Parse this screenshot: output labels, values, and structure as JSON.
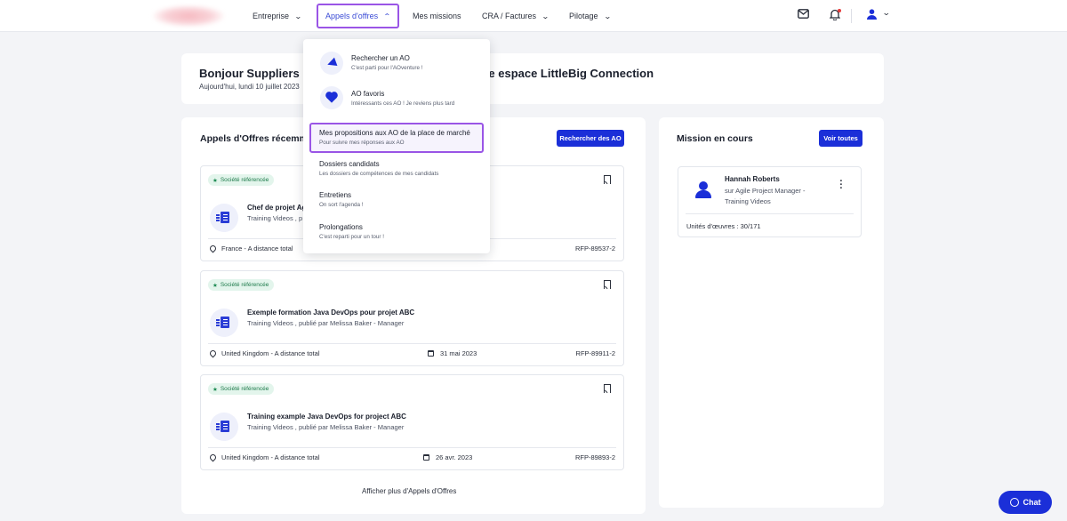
{
  "nav": {
    "items": [
      {
        "label": "Entreprise"
      },
      {
        "label": "Appels d'offres"
      },
      {
        "label": "Mes missions"
      },
      {
        "label": "CRA / Factures"
      },
      {
        "label": "Pilotage"
      }
    ],
    "icons": [
      "mail-icon",
      "bell-icon",
      "user-icon",
      "chevron-down-icon"
    ]
  },
  "dropdown": {
    "items": [
      {
        "label": "Rechercher un AO",
        "sub": "C'est parti pour l'AOventure !",
        "icon": "paper-plane-icon"
      },
      {
        "label": "AO favoris",
        "sub": "Intéressants ces AO ! Je reviens plus tard",
        "icon": "heart-icon"
      },
      {
        "label": "Mes propositions aux AO de la place de marché",
        "sub": "Pour suivre mes réponses aux AO"
      },
      {
        "label": "Dossiers candidats",
        "sub": "Les dossiers de compétences de mes candidats"
      },
      {
        "label": "Entretiens",
        "sub": "On sort l'agenda !"
      },
      {
        "label": "Prolongations",
        "sub": "C'est reparti pour un tour !"
      }
    ]
  },
  "welcome": {
    "title_left": "Bonjour Suppliers",
    "title_right": "tre espace LittleBig Connection",
    "date": "Aujourd'hui, lundi 10 juillet 2023"
  },
  "offers": {
    "title": "Appels d'Offres récemm",
    "search_button": "Rechercher des AO",
    "badge": "Société référencée",
    "items": [
      {
        "title": "Chef de projet Ag",
        "sub": "Training Videos , p",
        "location": "France - A distance total",
        "date": "",
        "ref": "RFP-89537-2"
      },
      {
        "title": "Exemple formation Java DevOps pour projet ABC",
        "sub": "Training Videos , publié par Melissa Baker - Manager",
        "location": "United Kingdom - A distance total",
        "date": "31 mai 2023",
        "ref": "RFP-89911-2"
      },
      {
        "title": "Training example Java DevOps for project ABC",
        "sub": "Training Videos , publié par Melissa Baker - Manager",
        "location": "United Kingdom - A distance total",
        "date": "26 avr. 2023",
        "ref": "RFP-89893-2"
      }
    ],
    "more_link": "Afficher plus d'Appels d'Offres"
  },
  "mission": {
    "title": "Mission en cours",
    "see_all": "Voir toutes",
    "name": "Hannah Roberts",
    "role": "sur Agile Project Manager - Training Videos",
    "units": "Unités d'œuvres : 30/171"
  },
  "chat": {
    "label": "Chat"
  },
  "colors": {
    "accent": "#1b2fd8",
    "highlight": "#9a55e6",
    "badge_bg": "#e3f5ec",
    "badge_text": "#1d7a4a"
  }
}
